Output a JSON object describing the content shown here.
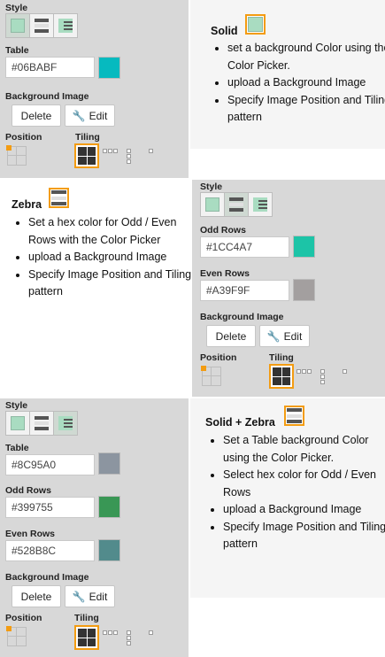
{
  "labels": {
    "style": "Style",
    "table": "Table",
    "odd_rows": "Odd Rows",
    "even_rows": "Even Rows",
    "background_image": "Background Image",
    "position": "Position",
    "tiling": "Tiling",
    "delete": "Delete",
    "edit": "Edit"
  },
  "panel1": {
    "table_color": "#06BABF",
    "table_swatch": "#06BABF"
  },
  "panel2": {
    "odd_color": "#1CC4A7",
    "odd_swatch": "#1CC4A7",
    "even_color": "#A39F9F",
    "even_swatch": "#A39F9F"
  },
  "panel3": {
    "table_color": "#8C95A0",
    "table_swatch": "#8C95A0",
    "odd_color": "#399755",
    "odd_swatch": "#399755",
    "even_color": "#528B8C",
    "even_swatch": "#528B8C"
  },
  "desc1": {
    "title": "Solid",
    "items": [
      "set a background Color using the Color Picker.",
      "upload a Background Image",
      "Specify Image Position and Tiling pattern"
    ]
  },
  "desc2": {
    "title": "Zebra",
    "items": [
      "Set a hex color for Odd / Even Rows with the Color Picker",
      "upload a Background Image",
      "Specify Image Position and Tiling pattern"
    ]
  },
  "desc3": {
    "title": "Solid + Zebra",
    "items": [
      "Set a Table background Color using the Color Picker.",
      "Select hex color for Odd / Even Rows",
      "upload a Background Image",
      "Specify Image Position and Tiling pattern"
    ]
  },
  "icons": {
    "wrench": "wrench-icon",
    "solid": "solid-style-icon",
    "zebra": "zebra-style-icon",
    "solid_zebra": "solid-zebra-style-icon"
  }
}
